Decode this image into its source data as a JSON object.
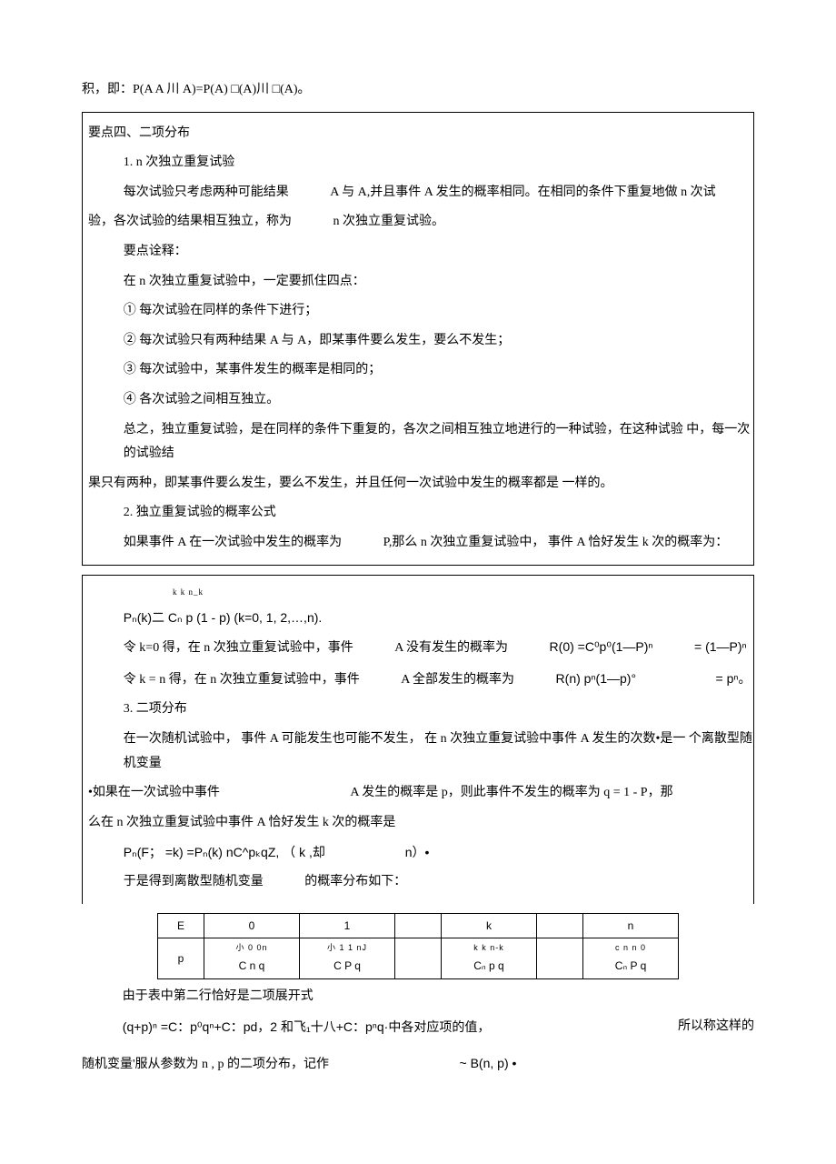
{
  "top_line": "积，即：P(A A 川 A)=P(A) □(A)川 □(A)。",
  "box1": {
    "l1": "要点四、二项分布",
    "l2": "1. n 次独立重复试验",
    "l3a": "每次试验只考虑两种可能结果",
    "l3b": "A 与 A,并且事件 A 发生的概率相同。在相同的条件下重复地做 n 次试",
    "l4a": "验，各次试验的结果相互独立，称为",
    "l4b": "n 次独立重复试验。",
    "l5": "要点诠释：",
    "l6": "在 n 次独立重复试验中，一定要抓住四点：",
    "l7": "① 每次试验在同样的条件下进行；",
    "l8": "② 每次试验只有两种结果 A 与 A，即某事件要么发生，要么不发生；",
    "l9": "③ 每次试验中，某事件发生的概率是相同的；",
    "l10": "④ 各次试验之间相互独立。",
    "l11": "总之，独立重复试验，是在同样的条件下重复的，各次之间相互独立地进行的一种试验，在这种试验 中，每一次的试验结",
    "l12": "果只有两种，即某事件要么发生，要么不发生，并且任何一次试验中发生的概率都是 一样的。",
    "l13": "2. 独立重复试验的概率公式",
    "l14a": "如果事件 A 在一次试验中发生的概率为",
    "l14b": "P,那么 n 次独立重复试验中， 事件 A 恰好发生 k 次的概率为："
  },
  "box2": {
    "sup": "k k                    n_k",
    "l1": "Pₙ(k)二 Cₙ p (1 - p)  (k=0, 1, 2,…,n).",
    "l2a": "令 k=0 得，在 n 次独立重复试验中，事件",
    "l2b": "A 没有发生的概率为",
    "l2c": "R(0) =C⁰p⁰(1—P)ⁿ",
    "l2d": "= (1—P)ⁿ",
    "l3a": "令 k   = n 得，在 n 次独立重复试验中，事件",
    "l3b": "A 全部发生的概率为",
    "l3c": "R(n) pⁿ(1—p)°",
    "l3d": "= pⁿ。",
    "l4": "3. 二项分布",
    "l5a": "在一次随机试验中， 事件 A 可能发生也可能不发生， 在 n 次独立重复试验中事件 A 发生的次数•是一 个离散型随机变量",
    "l6a": "•如果在一次试验中事件",
    "l6b": "A 发生的概率是 p，则此事件不发生的概率为 q = 1 - P，那",
    "l7": "么在 n 次独立重复试验中事件 A 恰好发生 k 次的概率是",
    "l8a": "Pₙ(F；   =k) =Pₙ(k) nC^pₖqZ,  （ k ,却",
    "l8b": "n）•",
    "l9a": "于是得到离散型随机变量",
    "l9b": "的概率分布如下："
  },
  "table": {
    "r1": [
      "E",
      "0",
      "1",
      "",
      "k",
      "",
      "n"
    ],
    "r2_head": "p",
    "r2_c1_top": "小 0  0n",
    "r2_c1_bot": "C  n  q",
    "r2_c2_top": "小 1  1  nJ",
    "r2_c2_bot": "C  P  q",
    "r2_c3": "",
    "r2_c4_top": "k k n-k",
    "r2_c4_bot": "Cₙ p  q",
    "r2_c5": "",
    "r2_c6_top": "c n n 0",
    "r2_c6_bot": "Cₙ P q"
  },
  "tail": {
    "l1": "由于表中第二行恰好是二项展开式",
    "l2a": "(q+p)ⁿ =C：p⁰qⁿ+C：pd，2 和飞₁十八+C：pⁿq·中各对应项的值，",
    "l2b": "所以称这样的",
    "l3a": "随机变量'服从参数为 n , p 的二项分布，记作",
    "l3b": "~ B(n, p) •"
  }
}
